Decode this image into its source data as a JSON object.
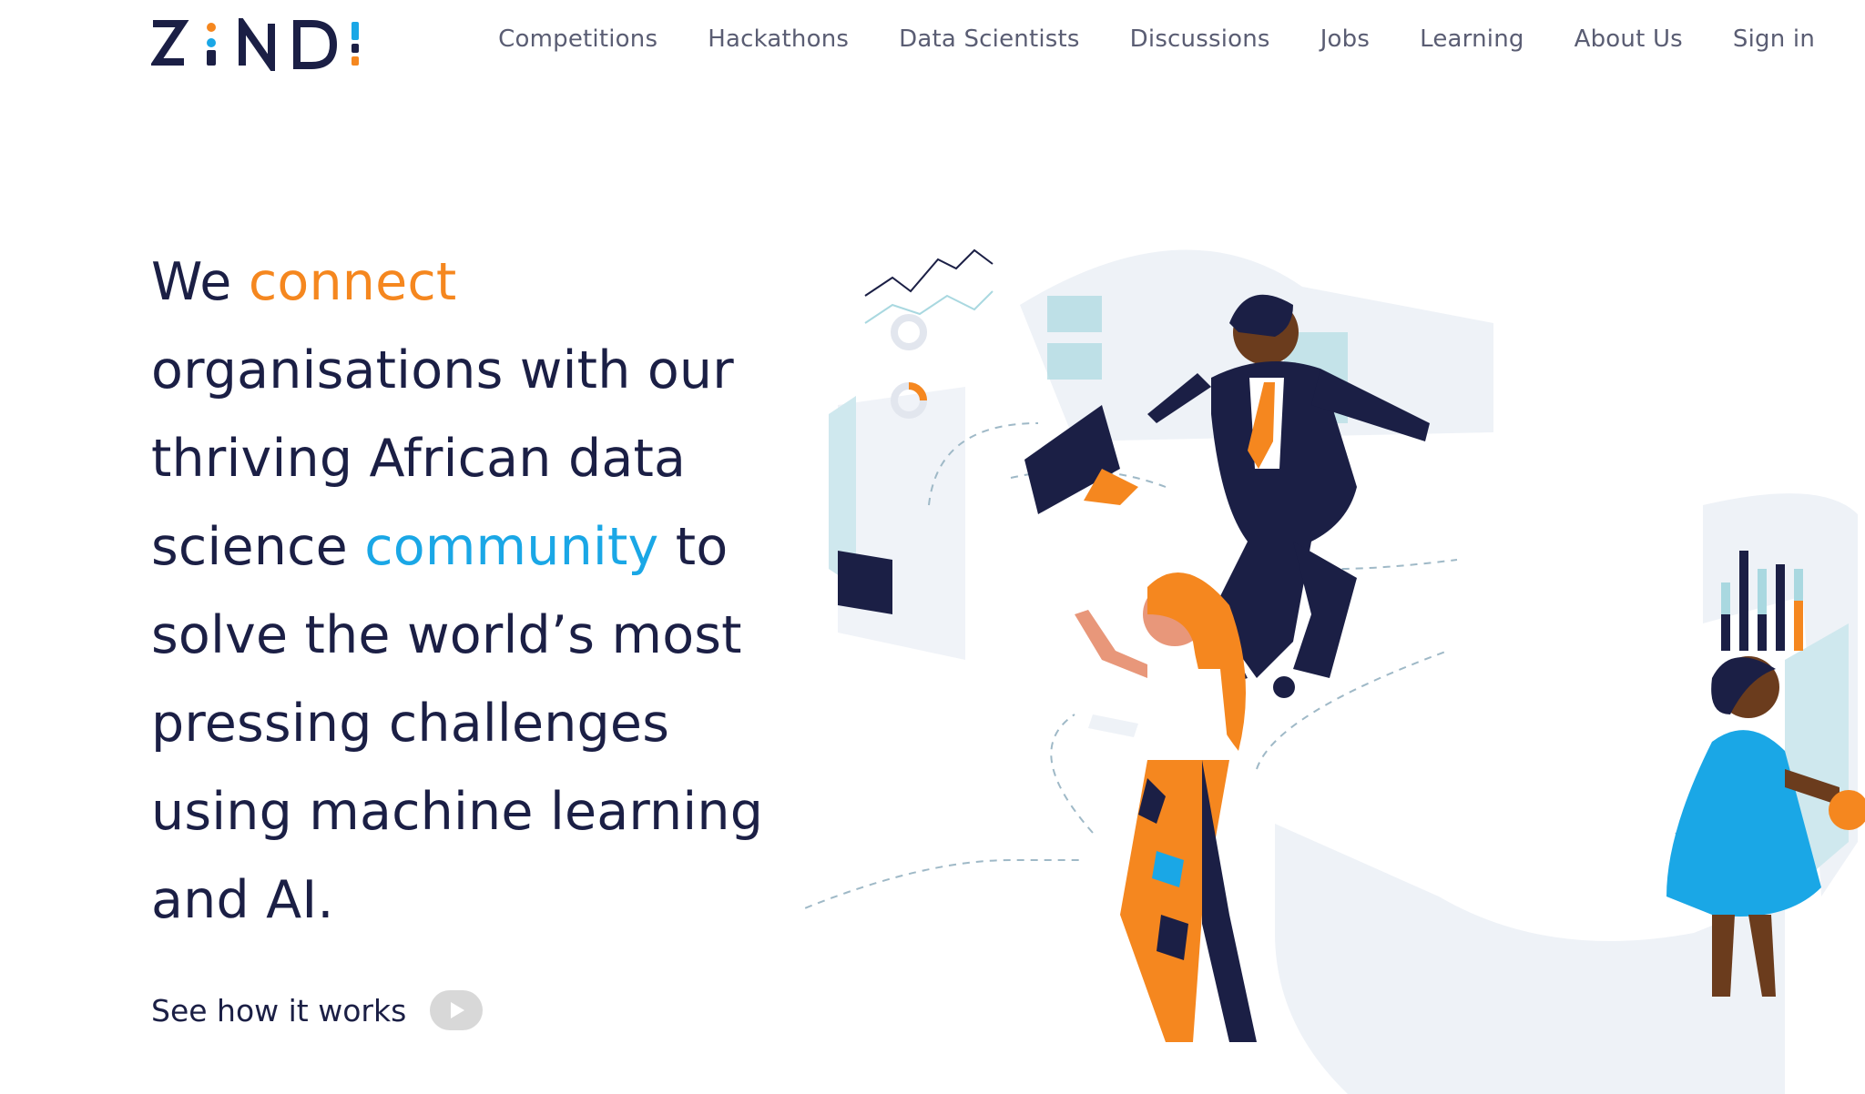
{
  "brand": {
    "name": "ZINDI",
    "colors": {
      "navy": "#1b1f45",
      "orange": "#f5871f",
      "blue": "#1aa7e6",
      "light_teal": "#a9d8e0"
    }
  },
  "nav": {
    "items": [
      {
        "label": "Competitions"
      },
      {
        "label": "Hackathons"
      },
      {
        "label": "Data Scientists"
      },
      {
        "label": "Discussions"
      },
      {
        "label": "Jobs"
      },
      {
        "label": "Learning"
      },
      {
        "label": "About Us"
      },
      {
        "label": "Sign in"
      }
    ]
  },
  "hero": {
    "w1": "We",
    "highlight1": "connect",
    "w2": "organisations with our thriving African data science",
    "highlight2": "community",
    "w3": "to solve the world’s most pressing challenges using machine learning and AI."
  },
  "cta": {
    "label": "See how it works",
    "icon": "play-icon"
  },
  "illustration": {
    "icon": "hero-illustration"
  }
}
